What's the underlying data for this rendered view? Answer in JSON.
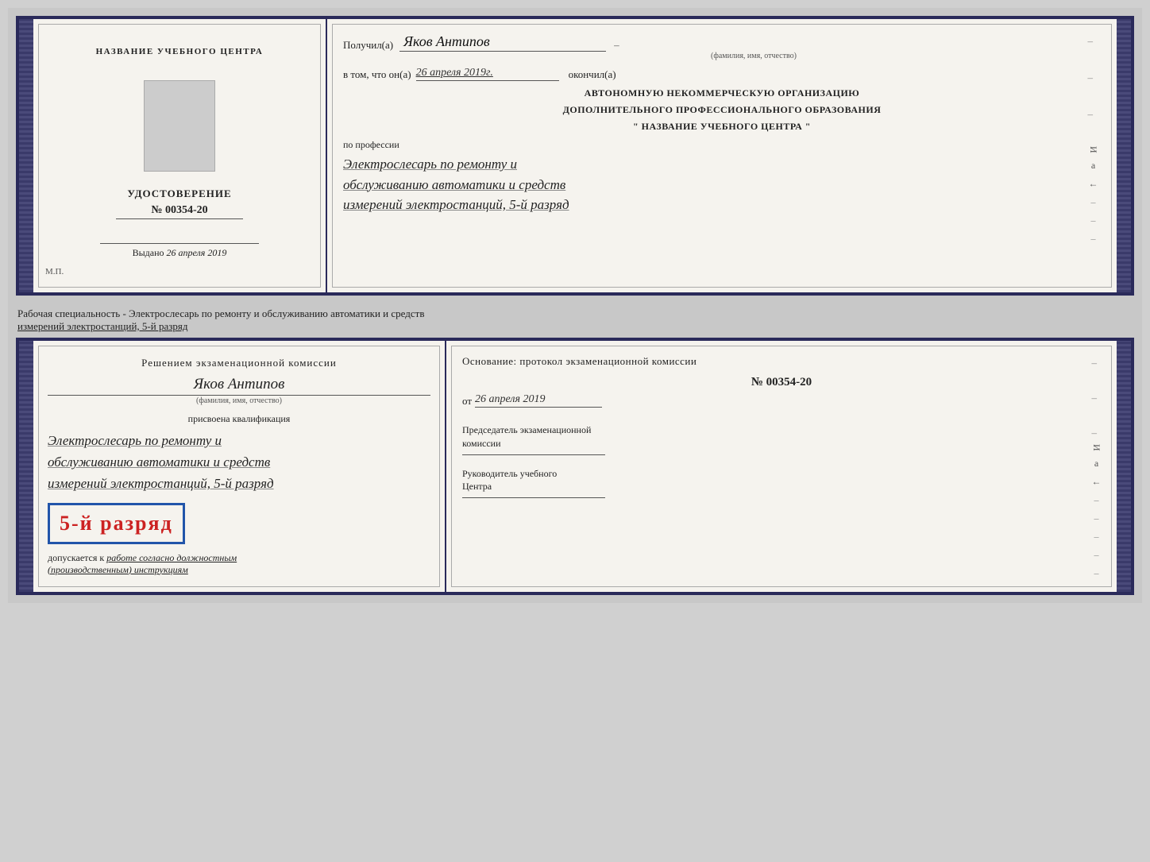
{
  "top_left": {
    "title": "НАЗВАНИЕ УЧЕБНОГО ЦЕНТРА",
    "cert_label": "УДОСТОВЕРЕНИЕ",
    "cert_number": "№ 00354-20",
    "issued_label": "Выдано",
    "issued_date": "26 апреля 2019",
    "mp_label": "М.П."
  },
  "top_right": {
    "received_label": "Получил(а)",
    "recipient_name": "Яков Антипов",
    "name_subtitle": "(фамилия, имя, отчество)",
    "certifies_label": "в том, что он(а)",
    "certifies_date": "26 апреля 2019г.",
    "finished_label": "окончил(а)",
    "org_line1": "АВТОНОМНУЮ НЕКОММЕРЧЕСКУЮ ОРГАНИЗАЦИЮ",
    "org_line2": "ДОПОЛНИТЕЛЬНОГО ПРОФЕССИОНАЛЬНОГО ОБРАЗОВАНИЯ",
    "org_quote": "\" НАЗВАНИЕ УЧЕБНОГО ЦЕНТРА \"",
    "profession_label": "по профессии",
    "profession_line1": "Электрослесарь по ремонту и",
    "profession_line2": "обслуживанию автоматики и средств",
    "profession_line3": "измерений электростанций, 5-й разряд"
  },
  "between_text": {
    "line1": "Рабочая специальность - Электрослесарь по ремонту и обслуживанию автоматики и средств",
    "line2": "измерений электростанций, 5-й разряд"
  },
  "bottom_left": {
    "decision_text": "Решением экзаменационной комиссии",
    "person_name": "Яков Антипов",
    "name_subtitle": "(фамилия, имя, отчество)",
    "assigned_label": "присвоена квалификация",
    "profession_line1": "Электрослесарь по ремонту и",
    "profession_line2": "обслуживанию автоматики и средств",
    "profession_line3": "измерений электростанций, 5-й разряд",
    "rank_text": "5-й разряд",
    "allowed_prefix": "допускается к",
    "allowed_handwriting": "работе согласно должностным",
    "allowed_handwriting2": "(производственным) инструкциям"
  },
  "bottom_right": {
    "basis_text": "Основание: протокол экзаменационной  комиссии",
    "number": "№  00354-20",
    "date_prefix": "от",
    "date_value": "26 апреля 2019",
    "chairman_label": "Председатель экзаменационной",
    "chairman_label2": "комиссии",
    "head_label": "Руководитель учебного",
    "head_label2": "Центра"
  },
  "right_strip": {
    "text1": "И",
    "text2": "а",
    "text3": "←",
    "dashes": [
      "–",
      "–",
      "–",
      "–",
      "–",
      "–",
      "–"
    ]
  }
}
